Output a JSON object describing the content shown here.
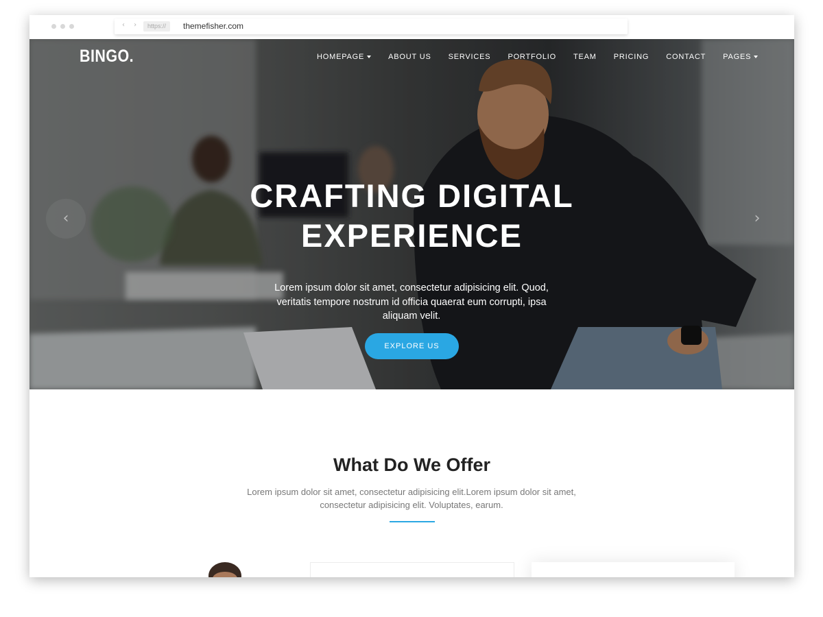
{
  "browser": {
    "protocol": "https://",
    "url": "themefisher.com",
    "nav_arrows": "‹ ›"
  },
  "header": {
    "logo": "BINGO.",
    "nav": [
      {
        "label": "HOMEPAGE",
        "has_caret": true
      },
      {
        "label": "ABOUT US",
        "has_caret": false
      },
      {
        "label": "SERVICES",
        "has_caret": false
      },
      {
        "label": "PORTFOLIO",
        "has_caret": false
      },
      {
        "label": "TEAM",
        "has_caret": false
      },
      {
        "label": "PRICING",
        "has_caret": false
      },
      {
        "label": "CONTACT",
        "has_caret": false
      },
      {
        "label": "PAGES",
        "has_caret": true
      }
    ]
  },
  "hero": {
    "title_line_1": "CRAFTING DIGITAL",
    "title_line_2": "EXPERIENCE",
    "text": "Lorem ipsum dolor sit amet, consectetur adipisicing elit. Quod, veritatis tempore nostrum id officia quaerat eum corrupti, ipsa aliquam velit.",
    "button_label": "EXPLORE US",
    "prev_arrow": "‹",
    "next_arrow": "›"
  },
  "offer": {
    "title": "What Do We Offer",
    "text": "Lorem ipsum dolor sit amet, consectetur adipisicing elit.Lorem ipsum dolor sit amet, consectetur adipisicing elit. Voluptates, earum."
  },
  "colors": {
    "accent": "#2aa7e3",
    "heading": "#222222",
    "body_text": "#777777"
  }
}
